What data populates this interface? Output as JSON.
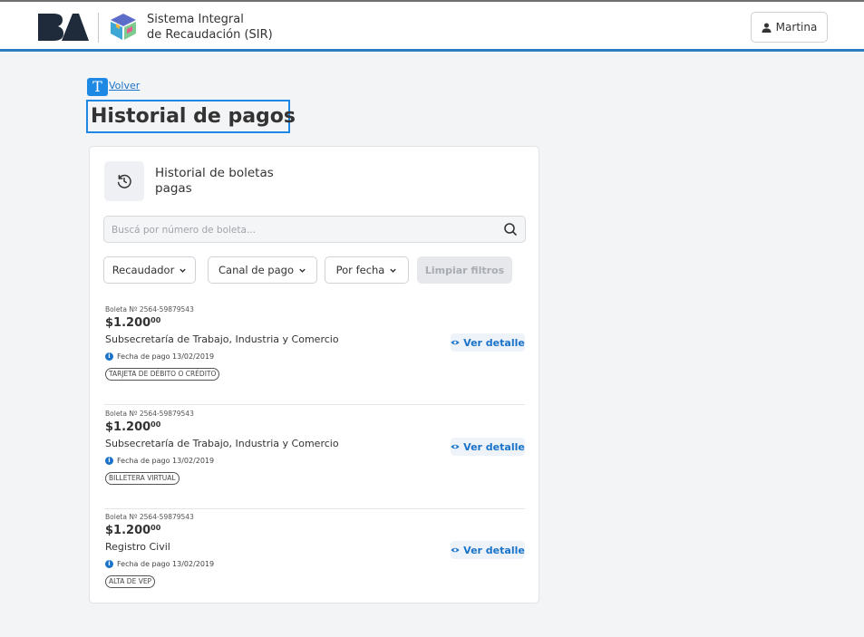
{
  "header": {
    "logo_alt": "BA",
    "system_title_line1": "Sistema Integral",
    "system_title_line2": "de Recaudación (SIR)",
    "user_name": "Martina"
  },
  "nav": {
    "back_icon_glyph": "T",
    "back_label": "Volver"
  },
  "page": {
    "title": "Historial de pagos"
  },
  "card": {
    "icon": "history-icon",
    "title": "Historial de boletas pagas"
  },
  "search": {
    "placeholder": "Buscá por número de boleta...",
    "value": "",
    "icon": "search-icon"
  },
  "filters": {
    "recaudador": "Recaudador",
    "canal": "Canal de pago",
    "fecha": "Por fecha",
    "limpiar": "Limpiar filtros"
  },
  "payments": [
    {
      "number": "Boleta Nº 2564-59879543",
      "amount": "$1.200",
      "cents": "00",
      "description": "Subsecretaría de Trabajo, Industria y Comercio",
      "date": "Fecha de pago 13/02/2019",
      "badge": "TARJETA DE DÉBITO O CRÉDITO",
      "action": "Ver detalle"
    },
    {
      "number": "Boleta Nº 2564-59879543",
      "amount": "$1.200",
      "cents": "00",
      "description": "Subsecretaría de Trabajo, Industria y Comercio",
      "date": "Fecha de pago 13/02/2019",
      "badge": "BILLETERA VIRTUAL",
      "action": "Ver detalle"
    },
    {
      "number": "Boleta Nº 2564-59879543",
      "amount": "$1.200",
      "cents": "00",
      "description": "Registro Civil",
      "date": "Fecha de pago 13/02/2019",
      "badge": "ALTA DE VEP",
      "action": "Ver detalle"
    }
  ],
  "colors": {
    "accent": "#1e88e5",
    "link": "#1a73c8",
    "header_border": "#2c7cc1",
    "logo_dark": "#1f2b3a"
  }
}
